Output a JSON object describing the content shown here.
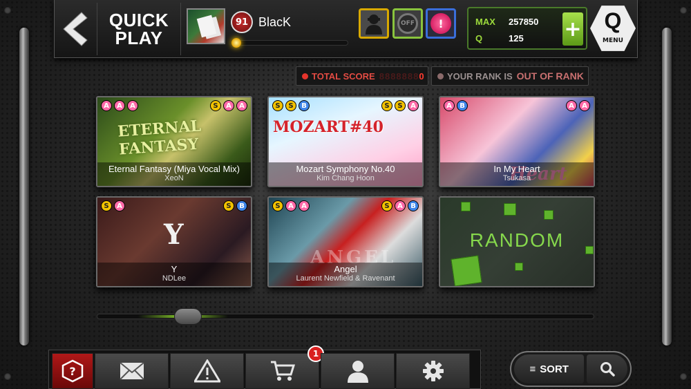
{
  "header": {
    "title_line1": "QUICK",
    "title_line2": "PLAY",
    "back_icon": "chevron-left-icon"
  },
  "player": {
    "name": "BlacK",
    "level": "91",
    "xp_progress_percent": 3
  },
  "modes": {
    "fader_icon": "fader-icon",
    "chaos_label": "OFF",
    "effector_icon": "fx-icon"
  },
  "scores": {
    "max_label": "MAX",
    "max_value": "257850",
    "q_label": "Q",
    "q_value": "125",
    "plus_label": "+"
  },
  "menu": {
    "q": "Q",
    "label": "MENU"
  },
  "stats": {
    "total_score_label": "TOTAL SCORE",
    "total_score_digits": "8888888",
    "total_score_value": "0",
    "rank_label": "YOUR RANK IS",
    "rank_value": "OUT OF RANK"
  },
  "songs": [
    {
      "title": "Eternal Fantasy (Miya Vocal Mix)",
      "artist": "XeoN",
      "ranks_left": [
        "A",
        "A",
        "A"
      ],
      "ranks_right": [
        "S",
        "A",
        "A"
      ],
      "art_text": "ETERNAL FANTASY"
    },
    {
      "title": "Mozart Symphony No.40",
      "artist": "Kim Chang Hoon",
      "ranks_left": [
        "S",
        "S",
        "B"
      ],
      "ranks_right": [
        "S",
        "S",
        "A"
      ],
      "art_text": "MOZART#40"
    },
    {
      "title": "In My Heart",
      "artist": "Tsukasa",
      "ranks_left": [
        "A",
        "B"
      ],
      "ranks_right": [
        "A",
        "A"
      ],
      "art_text": "Heart"
    },
    {
      "title": "Y",
      "artist": "NDLee",
      "ranks_left": [
        "S",
        "A"
      ],
      "ranks_right": [
        "S",
        "B"
      ],
      "art_text": "Y"
    },
    {
      "title": "Angel",
      "artist": "Laurent Newfield & Ravenant",
      "ranks_left": [
        "S",
        "A",
        "A"
      ],
      "ranks_right": [
        "S",
        "A",
        "B"
      ],
      "art_text": "ANGEL"
    }
  ],
  "random_card": {
    "label": "RANDOM"
  },
  "bottom_nav": {
    "help_icon": "help-icon",
    "mail_icon": "mail-icon",
    "warning_icon": "warning-icon",
    "cart_icon": "cart-icon",
    "cart_badge": "1",
    "profile_icon": "user-icon",
    "settings_icon": "gear-icon"
  },
  "sort": {
    "label": "SORT",
    "search_icon": "search-icon"
  },
  "colors": {
    "accent_green": "#8ad12c",
    "accent_red": "#e5342c",
    "rank_A": "#ff6aa8",
    "rank_S": "#f2c200",
    "rank_B": "#3e84e8"
  }
}
